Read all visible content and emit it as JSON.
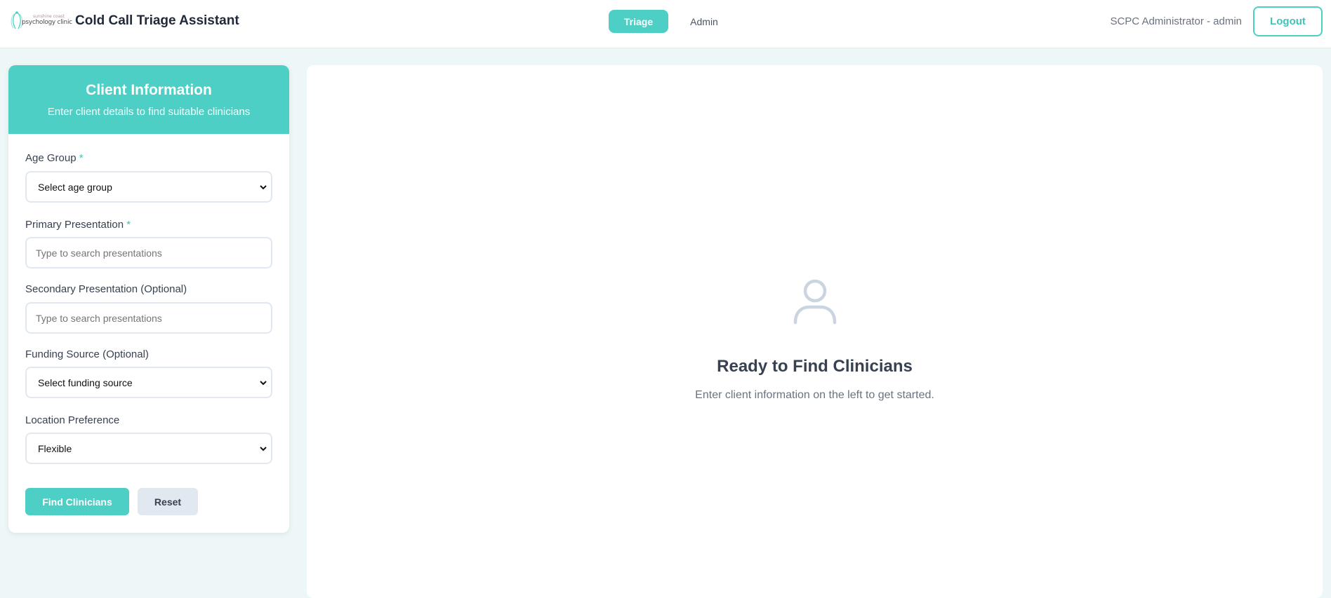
{
  "header": {
    "logo_small_text": "sunshine coast",
    "logo_main_text": "psychology clinic",
    "app_title": "Cold Call Triage Assistant",
    "nav": {
      "triage_label": "Triage",
      "admin_label": "Admin"
    },
    "user_label": "SCPC Administrator - admin",
    "logout_label": "Logout"
  },
  "form": {
    "title": "Client Information",
    "subtitle": "Enter client details to find suitable clinicians",
    "age_group": {
      "label": "Age Group",
      "required_mark": "*",
      "selected": "Select age group"
    },
    "primary_presentation": {
      "label": "Primary Presentation",
      "required_mark": "*",
      "placeholder": "Type to search presentations"
    },
    "secondary_presentation": {
      "label": "Secondary Presentation (Optional)",
      "placeholder": "Type to search presentations"
    },
    "funding_source": {
      "label": "Funding Source (Optional)",
      "selected": "Select funding source"
    },
    "location_preference": {
      "label": "Location Preference",
      "selected": "Flexible"
    },
    "find_button": "Find Clinicians",
    "reset_button": "Reset"
  },
  "results": {
    "icon": "user-icon",
    "title": "Ready to Find Clinicians",
    "subtitle": "Enter client information on the left to get started."
  },
  "colors": {
    "accent": "#4ecfc5",
    "background": "#eef7f7",
    "secondary_button": "#e2e8f0"
  }
}
